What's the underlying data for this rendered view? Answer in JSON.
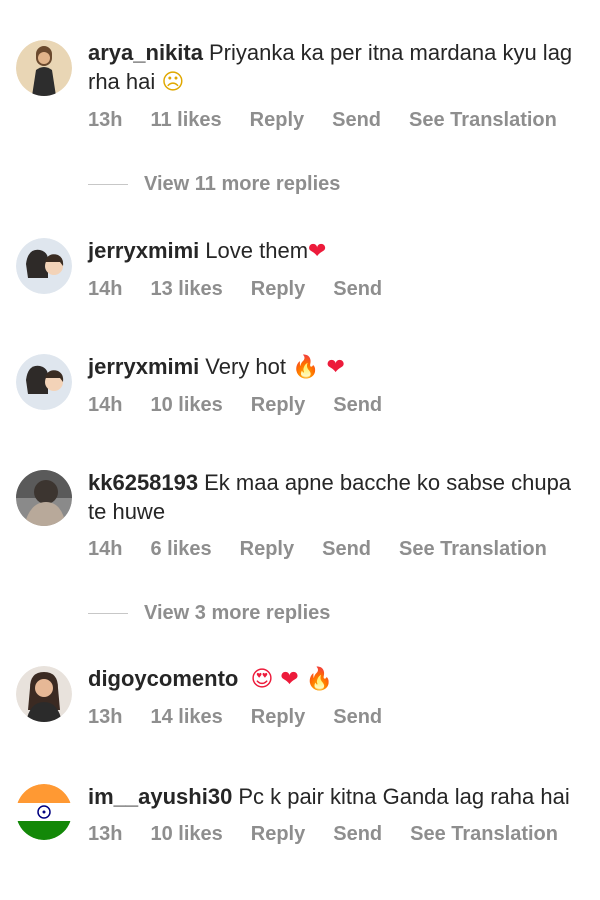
{
  "comments": [
    {
      "username": "arya_nikita",
      "text": "Priyanka ka per itna mardana kyu lag rha hai",
      "emoji": "☹",
      "time": "13h",
      "likes": "11 likes",
      "reply": "Reply",
      "send": "Send",
      "translate": "See Translation"
    },
    {
      "username": "jerryxmimi",
      "text": "Love them",
      "emoji": "❤",
      "time": "14h",
      "likes": "13 likes",
      "reply": "Reply",
      "send": "Send"
    },
    {
      "username": "jerryxmimi",
      "text": "Very hot",
      "emoji": "🔥 ❤",
      "time": "14h",
      "likes": "10 likes",
      "reply": "Reply",
      "send": "Send"
    },
    {
      "username": "kk6258193",
      "text": "Ek maa apne bacche ko sabse chupa te huwe",
      "time": "14h",
      "likes": "6 likes",
      "reply": "Reply",
      "send": "Send",
      "translate": "See Translation"
    },
    {
      "username": "digoycomento",
      "text": "",
      "emoji": "😍 ❤ 🔥",
      "time": "13h",
      "likes": "14 likes",
      "reply": "Reply",
      "send": "Send"
    },
    {
      "username": "im__ayushi30",
      "text": "Pc k pair kitna Ganda lag raha hai",
      "time": "13h",
      "likes": "10 likes",
      "reply": "Reply",
      "send": "Send",
      "translate": "See Translation"
    }
  ],
  "view_more": [
    "View 11 more replies",
    "View 3 more replies"
  ],
  "colors": {
    "text": "#262626",
    "meta": "#8e8e8e",
    "heart": "#ed1b3b",
    "fire": "#f57c00"
  }
}
